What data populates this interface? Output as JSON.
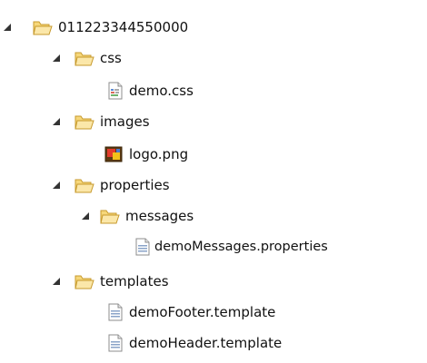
{
  "tree": {
    "root": {
      "label": "011223344550000",
      "icon": "folder-open-icon",
      "expanded": true,
      "children": [
        {
          "label": "css",
          "icon": "folder-open-icon",
          "expanded": true,
          "children": [
            {
              "label": "demo.css",
              "icon": "css-file-icon"
            }
          ]
        },
        {
          "label": "images",
          "icon": "folder-open-icon",
          "expanded": true,
          "children": [
            {
              "label": "logo.png",
              "icon": "image-file-icon"
            }
          ]
        },
        {
          "label": "properties",
          "icon": "folder-open-icon",
          "expanded": true,
          "children": [
            {
              "label": "messages",
              "icon": "folder-open-icon",
              "expanded": true,
              "children": [
                {
                  "label": "demoMessages.properties",
                  "icon": "text-file-icon"
                }
              ]
            }
          ]
        },
        {
          "label": "templates",
          "icon": "folder-open-icon",
          "expanded": true,
          "children": [
            {
              "label": "demoFooter.template",
              "icon": "text-file-icon"
            },
            {
              "label": "demoHeader.template",
              "icon": "text-file-icon"
            }
          ]
        }
      ]
    }
  },
  "colors": {
    "folder_fill": "#f6d77a",
    "folder_stroke": "#c79a2c",
    "text": "#111111",
    "toggle": "#333333"
  }
}
